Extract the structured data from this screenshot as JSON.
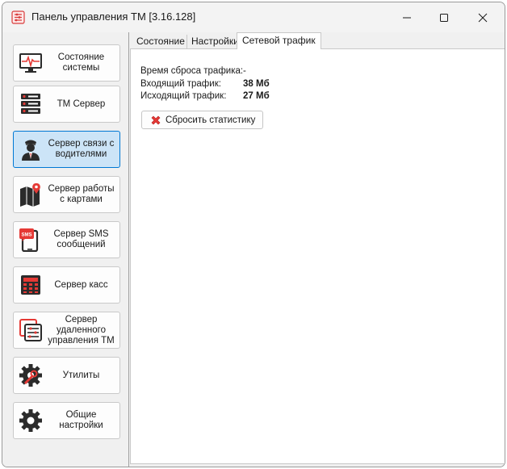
{
  "window": {
    "title": "Панель управления ТМ [3.16.128]",
    "icons": {
      "app": "control-panel-icon",
      "minimize": "minimize-icon",
      "maximize": "maximize-icon",
      "close": "close-icon"
    }
  },
  "sidebar": {
    "items": [
      {
        "label": "Состояние системы",
        "icon": "monitor-pulse-icon",
        "active": false
      },
      {
        "label": "ТМ Сервер",
        "icon": "server-icon",
        "active": false
      },
      {
        "label": "Сервер связи с водителями",
        "icon": "driver-icon",
        "active": true
      },
      {
        "label": "Сервер работы с картами",
        "icon": "map-pin-icon",
        "active": false
      },
      {
        "label": "Сервер SMS сообщений",
        "icon": "sms-phone-icon",
        "active": false
      },
      {
        "label": "Сервер касс",
        "icon": "cash-register-icon",
        "active": false
      },
      {
        "label": "Сервер удаленного управления ТМ",
        "icon": "remote-control-icon",
        "active": false
      },
      {
        "label": "Утилиты",
        "icon": "tools-gear-icon",
        "active": false
      },
      {
        "label": "Общие настройки",
        "icon": "settings-gear-icon",
        "active": false
      }
    ]
  },
  "tabs": [
    {
      "label": "Состояние",
      "active": false
    },
    {
      "label": "Настройки",
      "active": false
    },
    {
      "label": "Сетевой трафик",
      "active": true
    }
  ],
  "traffic": {
    "reset_time_label": "Время сброса трафика:",
    "reset_time_value": "-",
    "incoming_label": "Входящий трафик:",
    "incoming_value": "38 Мб",
    "outgoing_label": "Исходящий трафик:",
    "outgoing_value": "27 Мб",
    "reset_button_label": "Сбросить статистику"
  },
  "colors": {
    "accent": "#0078d4",
    "active_item_bg": "#cce4f7",
    "icon_red": "#e53935",
    "icon_dark": "#2b2b2b"
  }
}
